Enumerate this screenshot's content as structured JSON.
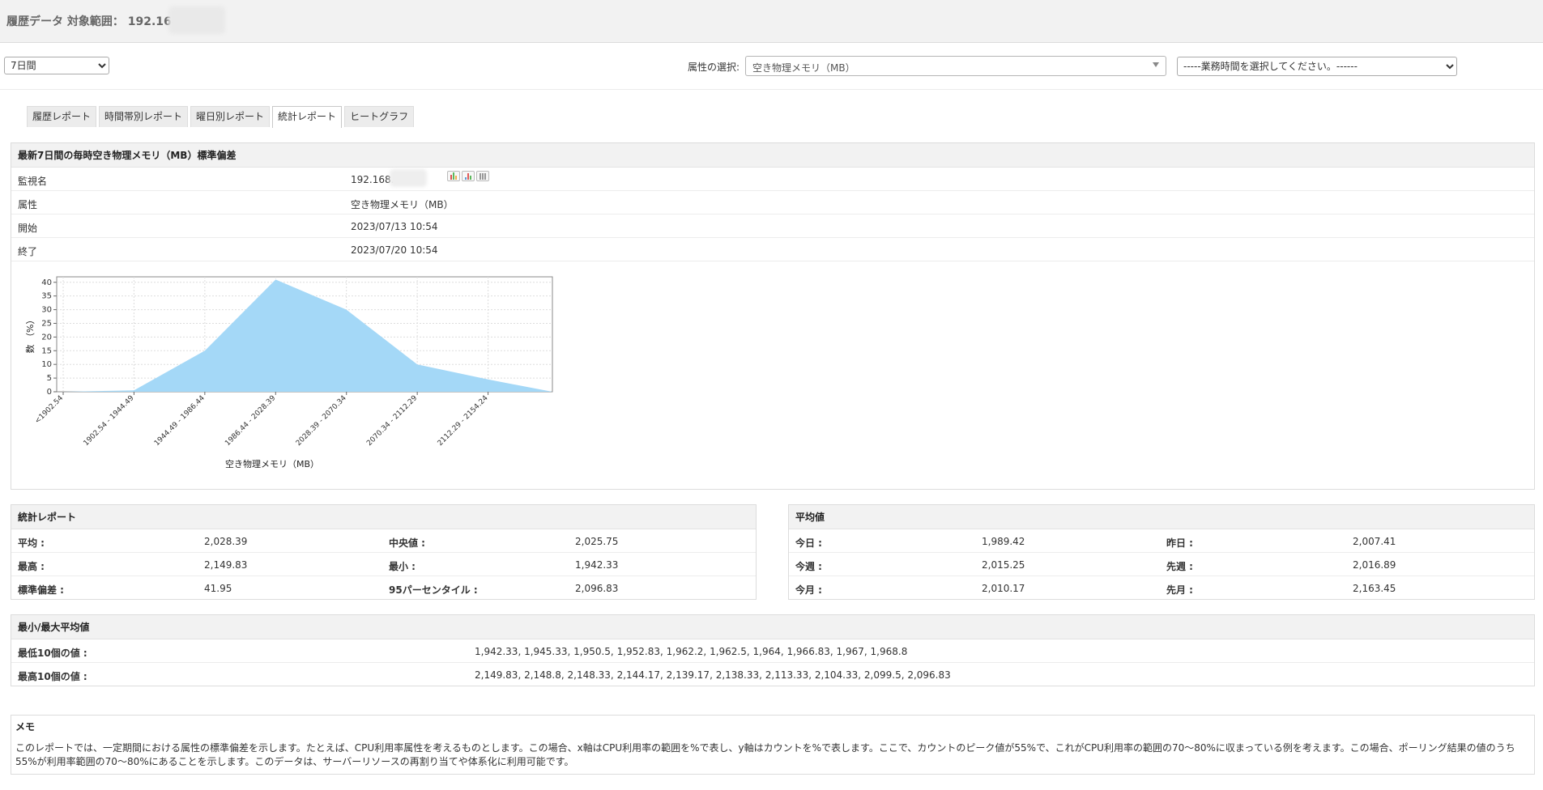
{
  "header": {
    "title": "履歴データ 対象範囲： 192.168"
  },
  "controls": {
    "period": "7日間",
    "attribute_label": "属性の選択:",
    "attribute_value": "空き物理メモリ（MB）",
    "business_hours": "-----業務時間を選択してください。------"
  },
  "tabs": [
    {
      "label": "履歴レポート"
    },
    {
      "label": "時間帯別レポート"
    },
    {
      "label": "曜日別レポート"
    },
    {
      "label": "統計レポート",
      "active": true
    },
    {
      "label": "ヒートグラフ"
    }
  ],
  "main": {
    "title": "最新7日間の毎時空き物理メモリ（MB）標準偏差",
    "rows": [
      {
        "label": "監視名",
        "value": "192.168."
      },
      {
        "label": "属性",
        "value": "空き物理メモリ（MB）"
      },
      {
        "label": "開始",
        "value": "2023/07/13 10:54"
      },
      {
        "label": "終了",
        "value": "2023/07/20 10:54"
      }
    ],
    "icons": [
      "bar-chart-icon",
      "line-chart-icon",
      "table-icon"
    ]
  },
  "chart_data": {
    "type": "area",
    "categories": [
      "<1902.54",
      "1902.54 - 1944.49",
      "1944.49 - 1986.44",
      "1986.44 - 2028.39",
      "2028.39 - 2070.34",
      "2070.34 - 2112.29",
      "2112.29 - 2154.24"
    ],
    "values": [
      0,
      0.5,
      15,
      41,
      30,
      10,
      4.5
    ],
    "end_value": 0,
    "xlabel": "空き物理メモリ（MB）",
    "ylabel": "数 （%）",
    "ylim": [
      0,
      42
    ],
    "yticks": [
      0,
      5,
      10,
      15,
      20,
      25,
      30,
      35,
      40
    ],
    "grid": true,
    "fill_color": "#a4d8f7"
  },
  "stats": {
    "title": "統計レポート",
    "rows": [
      [
        {
          "label": "平均 :",
          "value": "2,028.39"
        },
        {
          "label": "中央値 :",
          "value": "2,025.75"
        }
      ],
      [
        {
          "label": "最高 :",
          "value": "2,149.83"
        },
        {
          "label": "最小 :",
          "value": "1,942.33"
        }
      ],
      [
        {
          "label": "標準偏差 :",
          "value": "41.95"
        },
        {
          "label": "95パーセンタイル :",
          "value": "2,096.83"
        }
      ]
    ]
  },
  "averages": {
    "title": "平均値",
    "rows": [
      [
        {
          "label": "今日 :",
          "value": "1,989.42"
        },
        {
          "label": "昨日 :",
          "value": "2,007.41"
        }
      ],
      [
        {
          "label": "今週 :",
          "value": "2,015.25"
        },
        {
          "label": "先週 :",
          "value": "2,016.89"
        }
      ],
      [
        {
          "label": "今月 :",
          "value": "2,010.17"
        },
        {
          "label": "先月 :",
          "value": "2,163.45"
        }
      ]
    ]
  },
  "minmax": {
    "title": "最小/最大平均値",
    "rows": [
      {
        "label": "最低10個の値 :",
        "value": "1,942.33, 1,945.33, 1,950.5, 1,952.83, 1,962.2, 1,962.5, 1,964, 1,966.83, 1,967, 1,968.8"
      },
      {
        "label": "最高10個の値 :",
        "value": "2,149.83, 2,148.8, 2,148.33, 2,144.17, 2,139.17, 2,138.33, 2,113.33, 2,104.33, 2,099.5, 2,096.83"
      }
    ]
  },
  "memo": {
    "title": "メモ",
    "text": "このレポートでは、一定期間における属性の標準偏差を示します。たとえば、CPU利用率属性を考えるものとします。この場合、x軸はCPU利用率の範囲を%で表し、y軸はカウントを%で表します。ここで、カウントのピーク値が55%で、これがCPU利用率の範囲の70～80%に収まっている例を考えます。この場合、ポーリング結果の値のうち55%が利用率範囲の70～80%にあることを示します。このデータは、サーバーリソースの再割り当てや体系化に利用可能です。"
  }
}
